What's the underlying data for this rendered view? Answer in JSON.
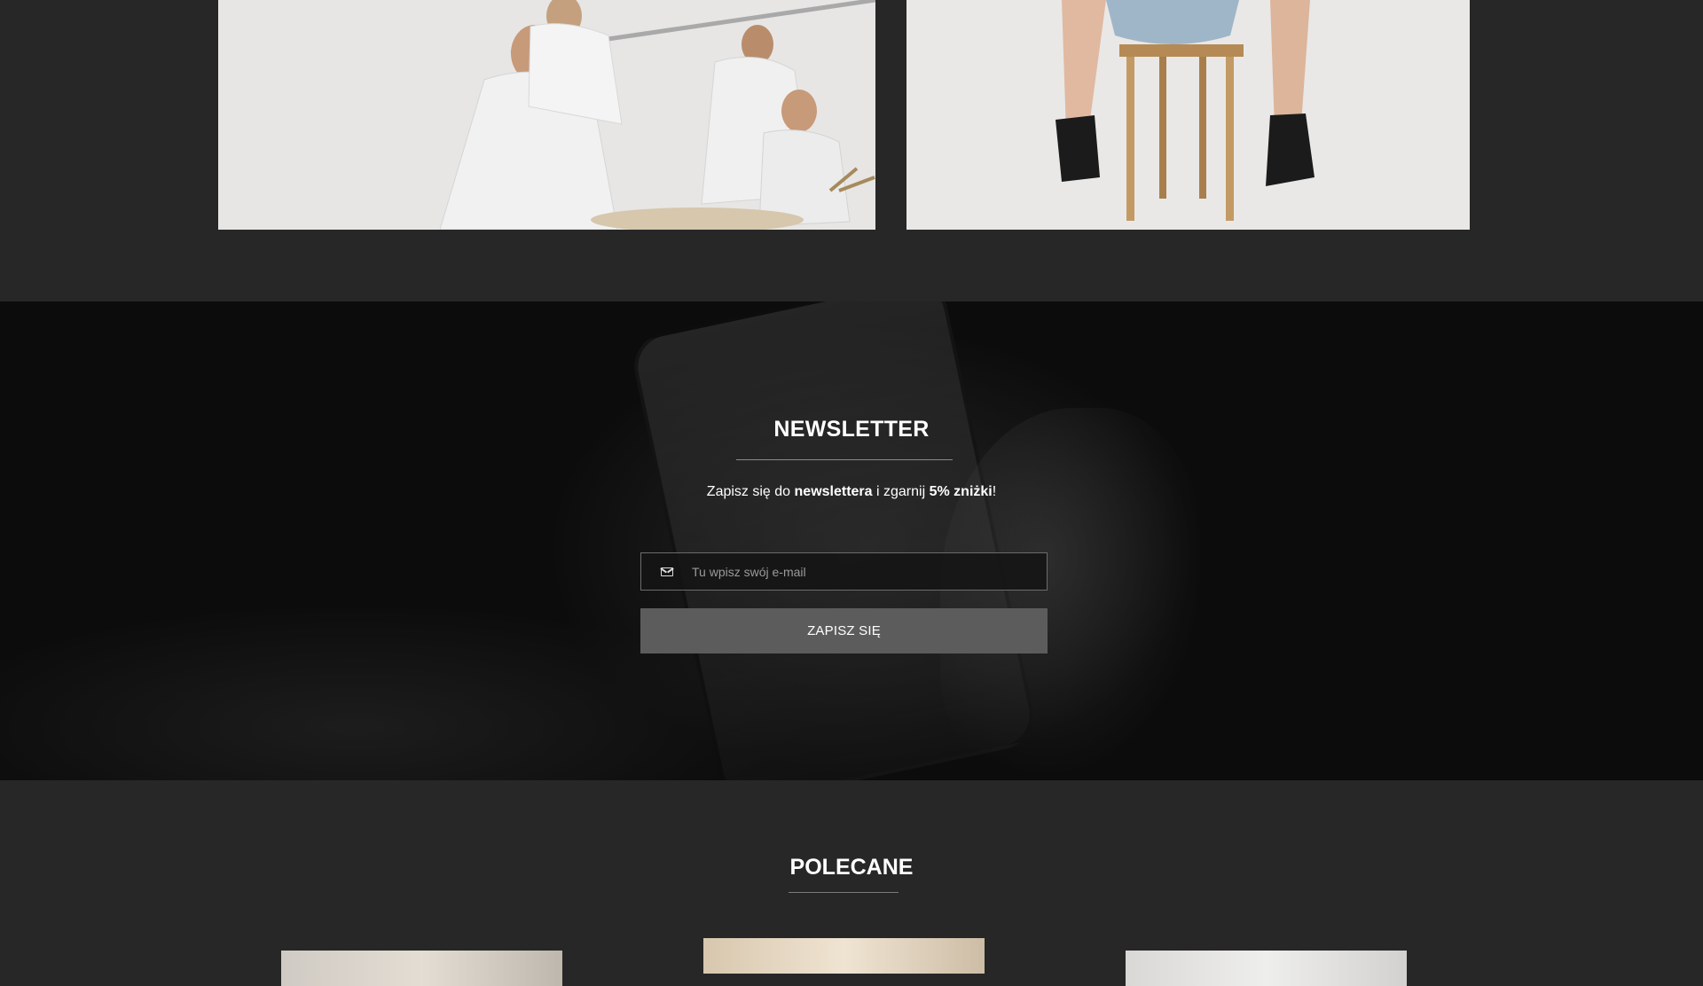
{
  "gallery": {
    "left_image_alt": "",
    "right_image_alt": ""
  },
  "newsletter": {
    "title": "NEWSLETTER",
    "text_prefix": "Zapisz się do ",
    "text_bold_1": "newslettera",
    "text_middle": " i zgarnij ",
    "text_bold_2": "5% zniżki",
    "text_suffix": "!",
    "email_placeholder": "Tu wpisz swój e-mail",
    "email_value": "",
    "subscribe_label": "ZAPISZ SIĘ",
    "icon": "mail-icon"
  },
  "recommended": {
    "title": "POLECANE"
  },
  "colors": {
    "page_background": "#272727",
    "newsletter_background": "#0c0c0c",
    "button_background": "#5c5c5c",
    "text": "#ffffff"
  }
}
